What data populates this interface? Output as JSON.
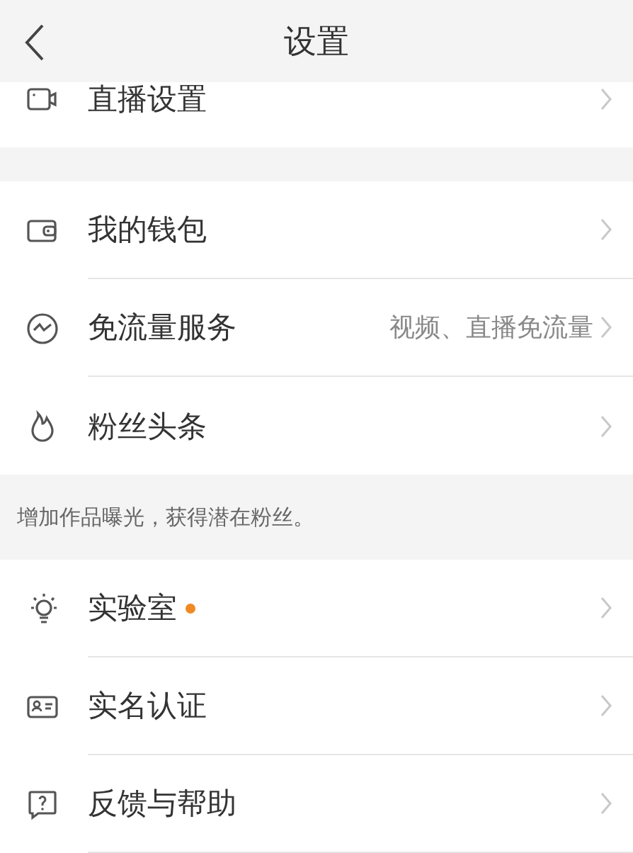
{
  "header": {
    "title": "设置"
  },
  "sections": [
    {
      "items": [
        {
          "label": "直播设置"
        }
      ]
    },
    {
      "items": [
        {
          "label": "我的钱包"
        },
        {
          "label": "免流量服务",
          "value": "视频、直播免流量"
        },
        {
          "label": "粉丝头条"
        }
      ],
      "note": "增加作品曝光，获得潜在粉丝。"
    },
    {
      "items": [
        {
          "label": "实验室",
          "dot": true
        },
        {
          "label": "实名认证"
        },
        {
          "label": "反馈与帮助"
        }
      ]
    }
  ]
}
